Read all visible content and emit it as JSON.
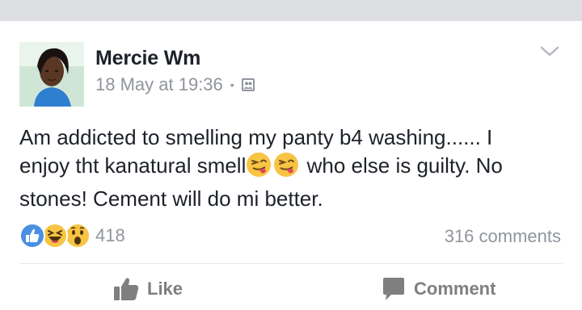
{
  "post": {
    "author": "Mercie Wm",
    "timestamp": "18 May at 19:36",
    "separator": "•",
    "audience_icon": "friends-icon",
    "text_line1": "Am addicted to smelling my panty b4 washing...... I",
    "text_part2a": "enjoy tht kanatural smell",
    "text_part2b": " who else is guilty. No",
    "text_line3": "stones! Cement will do mi better.",
    "inline_emoji": [
      "tongue-wink-emoji",
      "tongue-wink-emoji"
    ]
  },
  "reactions": {
    "icons": [
      "like-icon",
      "haha-icon",
      "wow-icon"
    ],
    "count": "418",
    "comments": "316 comments"
  },
  "actions": {
    "like_label": "Like",
    "comment_label": "Comment"
  },
  "colors": {
    "like_blue": "#4a90e2",
    "emoji_yellow": "#f7c443",
    "text": "#1d2129",
    "meta": "#90949c"
  }
}
